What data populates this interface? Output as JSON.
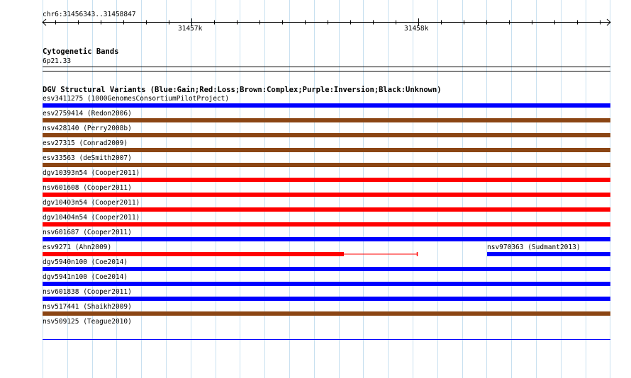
{
  "header": {
    "region": "chr6:31456343..31458847"
  },
  "scale": {
    "start": 31456343,
    "end": 31458847,
    "ticks": [
      {
        "label": "31457k",
        "pos": 31457000
      },
      {
        "label": "31458k",
        "pos": 31458000
      }
    ]
  },
  "cytoband": {
    "title": "Cytogenetic Bands",
    "band": "6p21.33"
  },
  "dgv": {
    "title": "DGV Structural Variants (Blue:Gain;Red:Loss;Brown:Complex;Purple:Inversion;Black:Unknown)",
    "colors": {
      "gain": "#0000ff",
      "loss": "#ff0000",
      "complex": "#8b4513"
    },
    "features": [
      {
        "label": "esv3411275 (1000GenomesConsortiumPilotProject)",
        "type": "gain"
      },
      {
        "label": "esv2759414 (Redon2006)",
        "type": "complex"
      },
      {
        "label": "nsv428140 (Perry2008b)",
        "type": "complex"
      },
      {
        "label": "esv27315 (Conrad2009)",
        "type": "complex"
      },
      {
        "label": "esv33563 (deSmith2007)",
        "type": "complex"
      },
      {
        "label": "dgv10393n54 (Cooper2011)",
        "type": "loss"
      },
      {
        "label": "nsv601608 (Cooper2011)",
        "type": "loss"
      },
      {
        "label": "dgv10403n54 (Cooper2011)",
        "type": "loss"
      },
      {
        "label": "dgv10404n54 (Cooper2011)",
        "type": "loss"
      },
      {
        "label": "nsv601687 (Cooper2011)",
        "type": "gain"
      },
      {
        "label": "esv9271 (Ahn2009)",
        "type": "loss",
        "split": true
      },
      {
        "label": "nsv970363 (Sudmant2013)",
        "type": "gain",
        "sameRowAsPrev": true
      },
      {
        "label": "dgv5940n100 (Coe2014)",
        "type": "gain"
      },
      {
        "label": "dgv5941n100 (Coe2014)",
        "type": "gain"
      },
      {
        "label": "nsv601838 (Cooper2011)",
        "type": "gain"
      },
      {
        "label": "nsv517441 (Shaikh2009)",
        "type": "complex"
      },
      {
        "label": "nsv509125 (Teague2010)",
        "type": "gain",
        "thin": true
      }
    ]
  }
}
